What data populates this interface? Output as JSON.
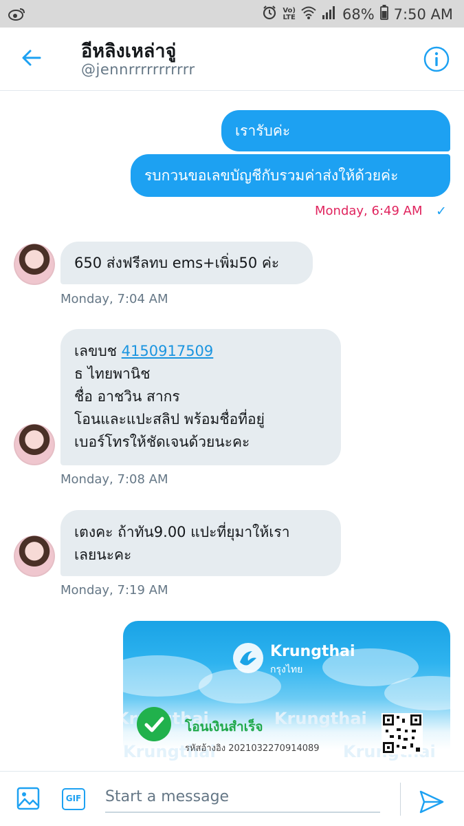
{
  "status_bar": {
    "network_label_top": "Vo)",
    "network_label_bottom": "LTE",
    "battery_percent": "68%",
    "time": "7:50 AM",
    "icons": [
      "weibo-icon",
      "alarm-icon",
      "wifi-icon",
      "signal-icon",
      "battery-icon"
    ]
  },
  "header": {
    "title": "อีหลิงเหล่าจู่",
    "handle": "@jennrrrrrrrrrrr",
    "back_icon": "back-arrow-icon",
    "info_icon": "info-icon"
  },
  "messages": [
    {
      "direction": "sent",
      "lines": [
        "เรารับค่ะ"
      ]
    },
    {
      "direction": "sent",
      "lines": [
        "รบกวนขอเลขบัญชีกับรวมค่าส่งให้ด้วยค่ะ"
      ]
    },
    {
      "direction": "recv",
      "lines": [
        "650 ส่งฟรีลทบ  ems+เพิ่ม50 ค่ะ"
      ]
    },
    {
      "direction": "recv",
      "account_prefix": "เลขบช ",
      "account_number": "4150917509",
      "lines": [
        "ธ ไทยพานิช",
        "ชื่อ อาชวิน สากร",
        "โอนและแปะสลิป พร้อมชื่อที่อยู่",
        "เบอร์โทรให้ชัดเจนด้วยนะคะ"
      ]
    },
    {
      "direction": "recv",
      "lines": [
        "เตงคะ ถ้าทัน9.00 แปะที่ยุมาให้เรา",
        "เลยนะคะ"
      ]
    }
  ],
  "timestamps": {
    "sent_1": "Monday, 6:49 AM",
    "recv_1": "Monday, 7:04 AM",
    "recv_2": "Monday, 7:08 AM",
    "recv_3": "Monday, 7:19 AM"
  },
  "read_mark": "✓",
  "slip": {
    "brand": "Krungthai",
    "brand_th": "กรุงไทย",
    "status": "โอนเงินสำเร็จ",
    "reference": "รหัสอ้างอิง 2021032270914089"
  },
  "composer": {
    "placeholder": "Start a message",
    "gif_label": "GIF"
  },
  "colors": {
    "accent": "#1da1f2",
    "received_bubble": "#e6ecf0",
    "sent_timestamp": "#e0245e",
    "success_green": "#21b14c"
  }
}
